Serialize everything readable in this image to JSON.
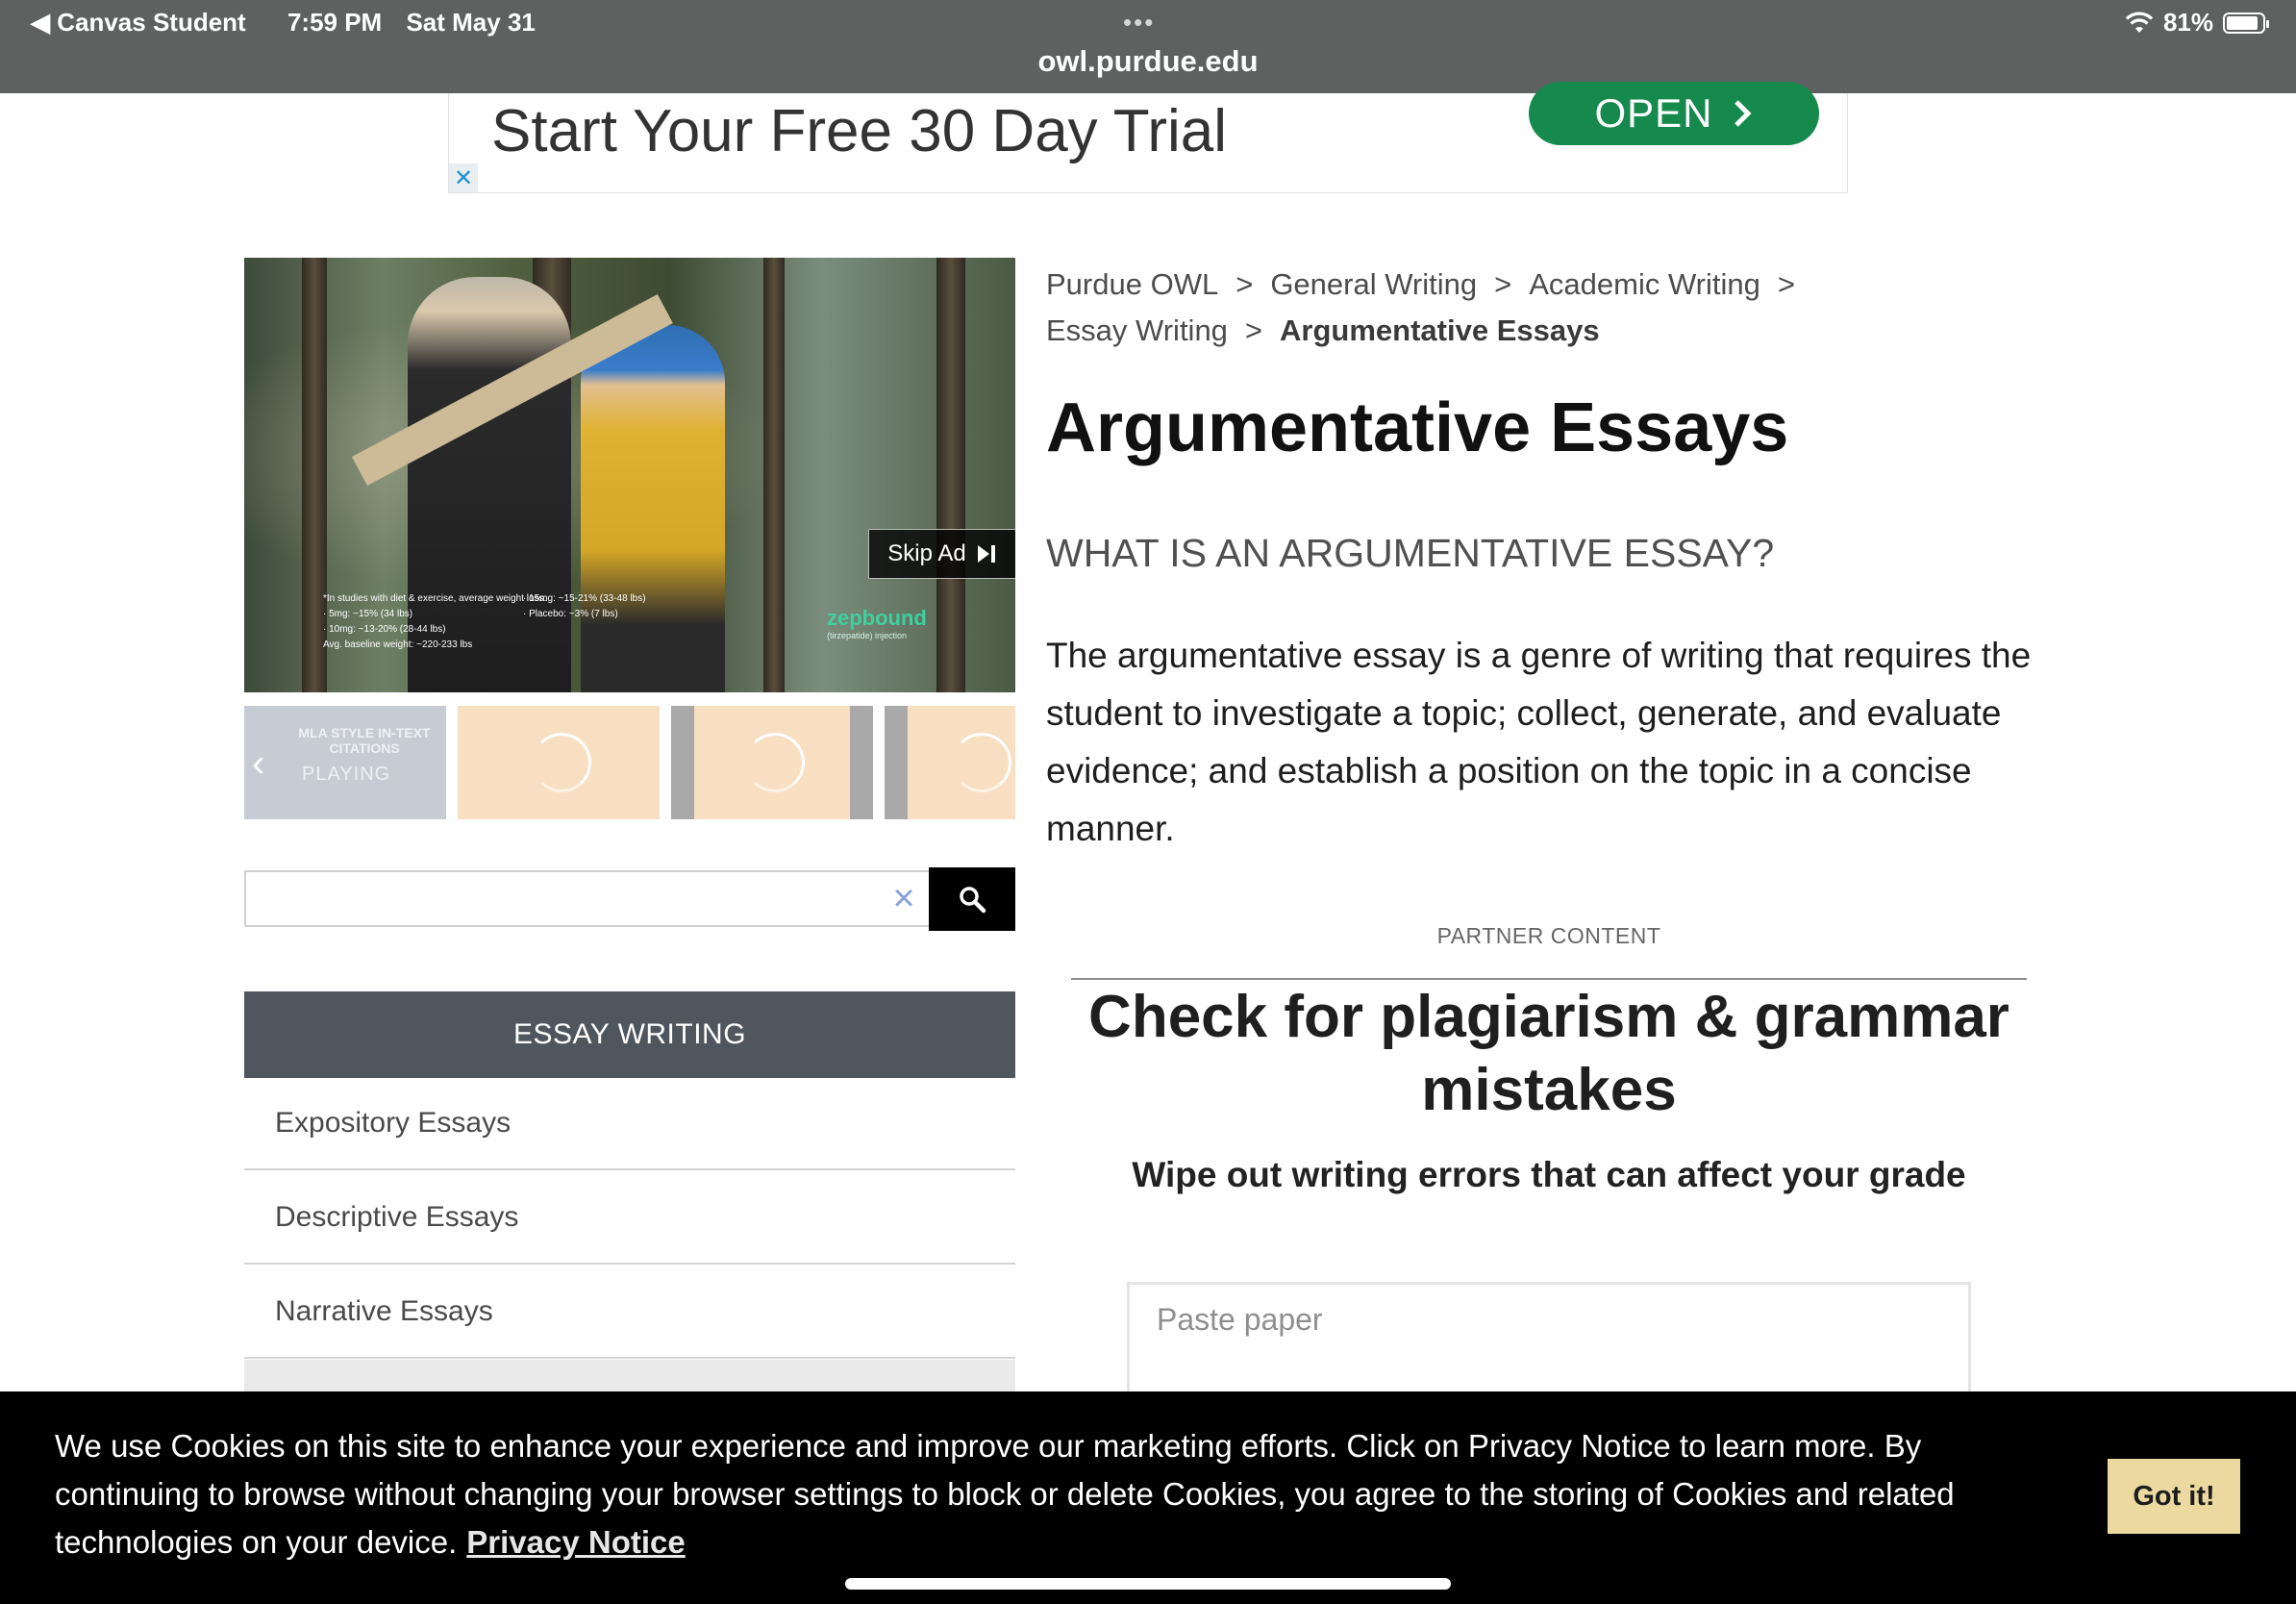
{
  "status_bar": {
    "back_app": "Canvas Student",
    "time": "7:59 PM",
    "date": "Sat May 31",
    "dots": "•••",
    "url": "owl.purdue.edu",
    "battery": "81%"
  },
  "ad": {
    "headline": "Start Your Free 30 Day Trial",
    "open_label": "OPEN",
    "close_label": "✕"
  },
  "video": {
    "skip_label": "Skip Ad",
    "disclaimer_col1": [
      "*In studies with diet & exercise, average weight loss:",
      "· 5mg: ~15% (34 lbs)",
      "· 10mg: ~13-20% (28-44 lbs)",
      "Avg. baseline weight: ~220-233 lbs"
    ],
    "disclaimer_col2": [
      "",
      "· 15mg: ~15-21% (33-48 lbs)",
      "· Placebo: ~3% (7 lbs)",
      ""
    ],
    "brand": "zepbound",
    "brand_sub": "(tirzepatide) injection"
  },
  "thumbnails": {
    "first_title": "MLA STYLE IN-TEXT CITATIONS",
    "first_status": "PLAYING"
  },
  "search": {
    "value": "",
    "placeholder": ""
  },
  "sidebar": {
    "header": "ESSAY WRITING",
    "items": [
      {
        "label": "Expository Essays"
      },
      {
        "label": "Descriptive Essays"
      },
      {
        "label": "Narrative Essays"
      }
    ]
  },
  "breadcrumb": {
    "items": [
      "Purdue OWL",
      "General Writing",
      "Academic Writing",
      "Essay Writing"
    ],
    "current": "Argumentative Essays",
    "separator": ">"
  },
  "main": {
    "title": "Argumentative Essays",
    "section_heading": "WHAT IS AN ARGUMENTATIVE ESSAY?",
    "intro": "The argumentative essay is a genre of writing that requires the student to investigate a topic; collect, generate, and evaluate evidence; and establish a position on the topic in a concise manner."
  },
  "partner": {
    "label": "PARTNER CONTENT",
    "title": "Check for plagiarism & grammar mistakes",
    "subtitle": "Wipe out writing errors that can affect your grade",
    "paste_placeholder": "Paste paper"
  },
  "cookie": {
    "text": "We use Cookies on this site to enhance your experience and improve our marketing efforts. Click on Privacy Notice to learn more. By continuing to browse without changing your browser settings to block or delete Cookies, you agree to the storing of Cookies and related technologies on your device.",
    "link": "Privacy Notice",
    "button": "Got it!"
  },
  "colors": {
    "topbar": "#5f6161",
    "ad_green": "#16894d",
    "nav_header": "#50565d",
    "cookie_button": "#ebd99f"
  }
}
